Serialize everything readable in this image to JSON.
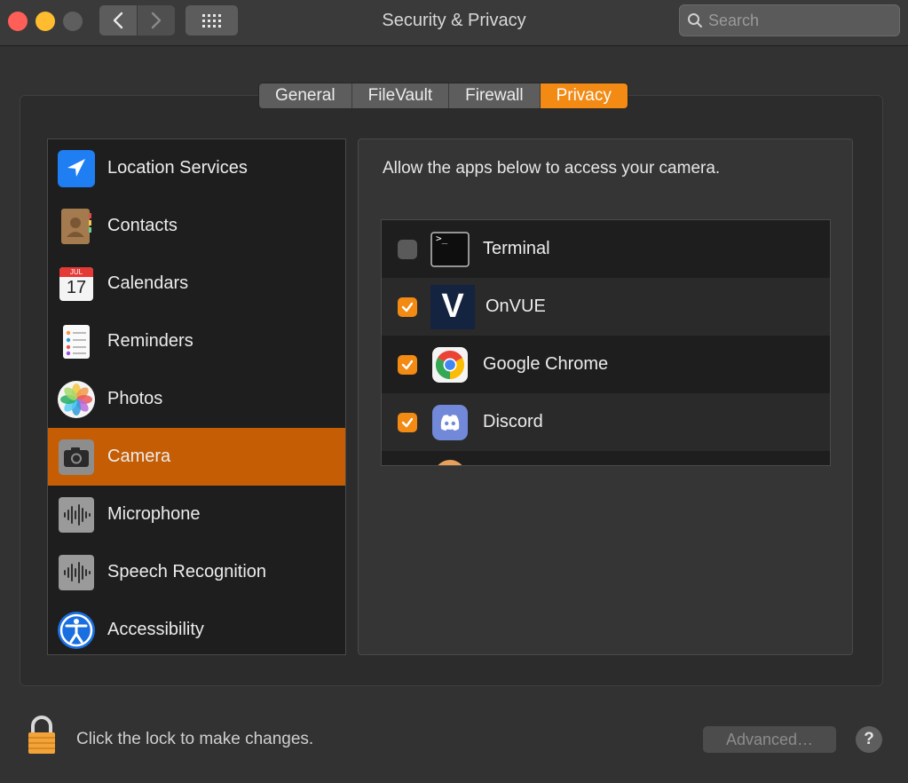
{
  "window": {
    "title": "Security & Privacy",
    "search_placeholder": "Search"
  },
  "tabs": [
    {
      "label": "General",
      "active": false
    },
    {
      "label": "FileVault",
      "active": false
    },
    {
      "label": "Firewall",
      "active": false
    },
    {
      "label": "Privacy",
      "active": true
    }
  ],
  "sidebar": {
    "items": [
      {
        "label": "Location Services",
        "icon": "location-arrow-icon",
        "selected": false
      },
      {
        "label": "Contacts",
        "icon": "contacts-book-icon",
        "selected": false
      },
      {
        "label": "Calendars",
        "icon": "calendar-icon",
        "selected": false,
        "icon_month": "JUL",
        "icon_day": "17"
      },
      {
        "label": "Reminders",
        "icon": "reminders-list-icon",
        "selected": false
      },
      {
        "label": "Photos",
        "icon": "photos-flower-icon",
        "selected": false
      },
      {
        "label": "Camera",
        "icon": "camera-icon",
        "selected": true
      },
      {
        "label": "Microphone",
        "icon": "microphone-waveform-icon",
        "selected": false
      },
      {
        "label": "Speech Recognition",
        "icon": "speech-waveform-icon",
        "selected": false
      },
      {
        "label": "Accessibility",
        "icon": "accessibility-person-icon",
        "selected": false
      }
    ]
  },
  "detail": {
    "description": "Allow the apps below to access your camera.",
    "apps": [
      {
        "name": "Terminal",
        "checked": false,
        "icon": "terminal-icon",
        "icon_text": ">_"
      },
      {
        "name": "OnVUE",
        "checked": true,
        "icon": "onvue-icon",
        "icon_text": "V"
      },
      {
        "name": "Google Chrome",
        "checked": true,
        "icon": "chrome-icon"
      },
      {
        "name": "Discord",
        "checked": true,
        "icon": "discord-icon"
      }
    ]
  },
  "footer": {
    "lock_text": "Click the lock to make changes.",
    "advanced_label": "Advanced…",
    "help_label": "?"
  },
  "colors": {
    "accent": "#f28a14",
    "selection": "#c55d04"
  }
}
